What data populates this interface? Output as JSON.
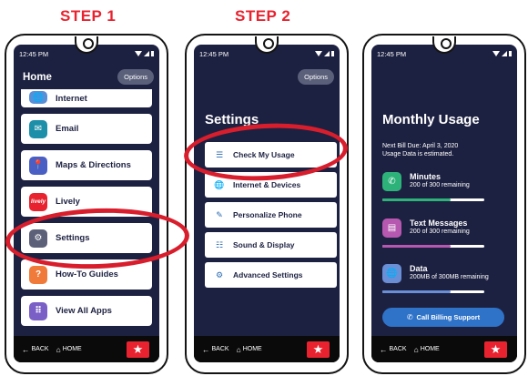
{
  "steps": [
    "STEP 1",
    "STEP 2"
  ],
  "status_time": "12:45 PM",
  "phone1": {
    "title": "Home",
    "options_label": "Options",
    "apps": [
      {
        "label": "Internet",
        "icon": "globe-icon",
        "glyph": "🌐",
        "color": "#5a8fd6"
      },
      {
        "label": "Email",
        "icon": "email-icon",
        "glyph": "✉",
        "color": "#1d8fa8"
      },
      {
        "label": "Maps & Directions",
        "icon": "map-pin-icon",
        "glyph": "📍",
        "color": "#4a5fc4"
      },
      {
        "label": "Lively",
        "icon": "lively-logo-icon",
        "glyph": "lively",
        "color": "#e8232f"
      },
      {
        "label": "Settings",
        "icon": "gear-icon",
        "glyph": "⚙",
        "color": "#5c6078"
      },
      {
        "label": "How-To Guides",
        "icon": "question-icon",
        "glyph": "?",
        "color": "#f07a3a"
      },
      {
        "label": "View All Apps",
        "icon": "app-grid-icon",
        "glyph": "⠿",
        "color": "#7a5fc7"
      }
    ]
  },
  "phone2": {
    "title": "Settings",
    "options_label": "Options",
    "items": [
      {
        "label": "Check My Usage",
        "icon": "usage-list-icon",
        "glyph": "☰"
      },
      {
        "label": "Internet & Devices",
        "icon": "globe-icon",
        "glyph": "🌐"
      },
      {
        "label": "Personalize Phone",
        "icon": "phone-personalize-icon",
        "glyph": "✎"
      },
      {
        "label": "Sound & Display",
        "icon": "sliders-icon",
        "glyph": "☷"
      },
      {
        "label": "Advanced Settings",
        "icon": "gear-icon",
        "glyph": "⚙"
      }
    ]
  },
  "phone3": {
    "title": "Monthly Usage",
    "bill_due": "Next Bill Due: April 3, 2020",
    "estimated_note": "Usage Data is estimated.",
    "usage": [
      {
        "title": "Minutes",
        "detail": "200 of 300 remaining",
        "icon": "phone-call-icon",
        "glyph": "✆",
        "color": "#2db37a",
        "remaining_fraction": 0.67
      },
      {
        "title": "Text Messages",
        "detail": "200 of 300 remaining",
        "icon": "chat-bubble-icon",
        "glyph": "▤",
        "color": "#b658b0",
        "remaining_fraction": 0.67
      },
      {
        "title": "Data",
        "detail": "200MB of 300MB remaining",
        "icon": "globe-icon",
        "glyph": "🌐",
        "color": "#6a8fd6",
        "remaining_fraction": 0.67
      }
    ],
    "billing_button": "Call Billing Support"
  },
  "nav": {
    "back": "BACK",
    "home": "HOME"
  },
  "colors": {
    "accent_red": "#e8232f",
    "screen_bg": "#1d2141",
    "billing_blue": "#2f73c9"
  }
}
